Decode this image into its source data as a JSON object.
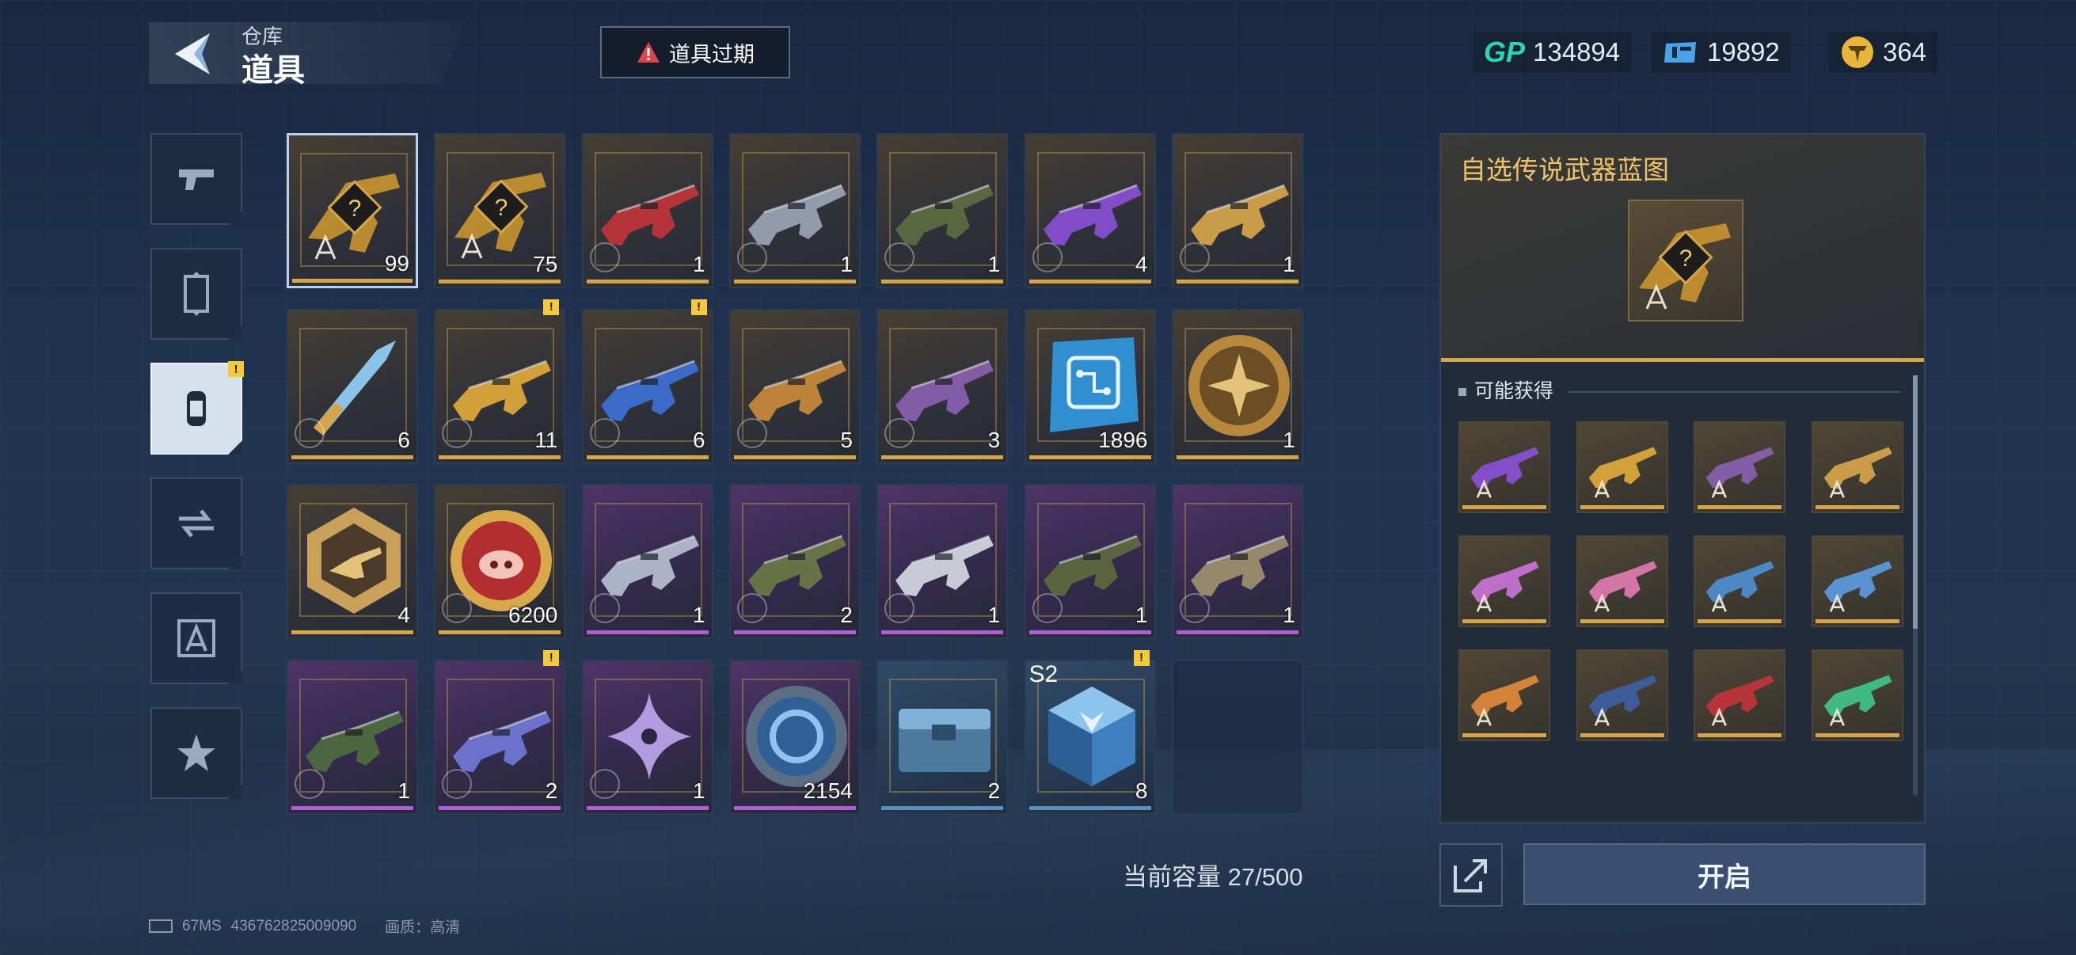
{
  "header": {
    "section_label": "仓库",
    "page_title": "道具",
    "expire_button_label": "道具过期"
  },
  "currencies": [
    {
      "icon": "gp-icon",
      "label": "GP",
      "value": "134894",
      "color": "#2fd3b0"
    },
    {
      "icon": "ticket-icon",
      "value": "19892",
      "color": "#4aa3e8"
    },
    {
      "icon": "gold-coin-icon",
      "value": "364",
      "color": "#e8b63a"
    }
  ],
  "side_nav": [
    {
      "icon": "pistol-icon",
      "active": false
    },
    {
      "icon": "skin-card-icon",
      "active": false
    },
    {
      "icon": "supply-item-icon",
      "active": true,
      "badge": "!"
    },
    {
      "icon": "transfer-icon",
      "active": false
    },
    {
      "icon": "blueprint-icon",
      "active": false
    },
    {
      "icon": "star-icon",
      "active": false
    }
  ],
  "items": [
    {
      "rarity": "gold",
      "art": "legendary-blueprint-icon",
      "count": "99",
      "selected": true
    },
    {
      "rarity": "gold",
      "art": "legendary-blueprint-icon",
      "count": "75"
    },
    {
      "rarity": "gold",
      "art": "red-rifle-icon",
      "count": "1",
      "timed": true,
      "accent": "#c0343b"
    },
    {
      "rarity": "gold",
      "art": "silver-rifle-icon",
      "count": "1",
      "timed": true,
      "accent": "#9aa4b6"
    },
    {
      "rarity": "gold",
      "art": "camo-rifle-icon",
      "count": "1",
      "timed": true,
      "accent": "#5c6b43"
    },
    {
      "rarity": "gold",
      "art": "purple-rifle-icon",
      "count": "4",
      "timed": true,
      "accent": "#8a4fd6"
    },
    {
      "rarity": "gold",
      "art": "gold-smg-icon",
      "count": "1",
      "timed": true,
      "accent": "#d6a54b"
    },
    {
      "rarity": "gold",
      "art": "knife-icon",
      "count": "6",
      "timed": true,
      "accent": "#8bc4e8"
    },
    {
      "rarity": "gold",
      "art": "gold-shotgun-icon",
      "count": "11",
      "timed": true,
      "badge": "!",
      "accent": "#e0a93a"
    },
    {
      "rarity": "gold",
      "art": "blue-rifle-icon",
      "count": "6",
      "timed": true,
      "badge": "!",
      "accent": "#3d6fd6"
    },
    {
      "rarity": "gold",
      "art": "pistol-icon",
      "count": "5",
      "timed": true,
      "accent": "#c98a3a"
    },
    {
      "rarity": "gold",
      "art": "sniper-rifle-icon",
      "count": "3",
      "timed": true,
      "accent": "#8a5fb0"
    },
    {
      "rarity": "gold",
      "art": "blueprint-chip-icon",
      "count": "1896",
      "accent": "#3f9ad6"
    },
    {
      "rarity": "gold",
      "art": "gold-cross-medal-icon",
      "count": "1",
      "accent": "#c99a45"
    },
    {
      "rarity": "gold",
      "art": "gold-hex-badge-icon",
      "count": "4",
      "accent": "#c99a45"
    },
    {
      "rarity": "gold",
      "art": "pig-coin-icon",
      "count": "6200",
      "timed": true,
      "accent": "#c23b3b"
    },
    {
      "rarity": "purple",
      "art": "silver-blaster-icon",
      "count": "1",
      "timed": true,
      "accent": "#b7bfd0"
    },
    {
      "rarity": "purple",
      "art": "camo-shotgun-icon",
      "count": "2",
      "timed": true,
      "accent": "#6b7a45"
    },
    {
      "rarity": "purple",
      "art": "white-rifle-icon",
      "count": "1",
      "timed": true,
      "accent": "#d5d9e0"
    },
    {
      "rarity": "purple",
      "art": "black-rifle-icon",
      "count": "1",
      "timed": true,
      "accent": "#5d6a3e"
    },
    {
      "rarity": "purple",
      "art": "tan-rifle-icon",
      "count": "1",
      "timed": true,
      "accent": "#a09070"
    },
    {
      "rarity": "purple",
      "art": "green-rifle-icon",
      "count": "1",
      "timed": true,
      "accent": "#4c6d3e"
    },
    {
      "rarity": "purple",
      "art": "blue-crossbow-icon",
      "count": "2",
      "timed": true,
      "badge": "!",
      "accent": "#6f78d6"
    },
    {
      "rarity": "purple",
      "art": "throwing-star-icon",
      "count": "1",
      "timed": true,
      "accent": "#a38ad6"
    },
    {
      "rarity": "purple",
      "art": "blue-token-icon",
      "count": "2154",
      "accent": "#3d8ac9"
    },
    {
      "rarity": "blue",
      "art": "supply-crate-icon",
      "count": "2",
      "accent": "#6fa9d0"
    },
    {
      "rarity": "blue",
      "art": "s2-cube-icon",
      "count": "8",
      "tag": "S2",
      "badge": "!",
      "accent": "#4e8fd0"
    },
    {
      "rarity": "empty"
    }
  ],
  "capacity_text": "当前容量 27/500",
  "detail_panel": {
    "title": "自选传说武器蓝图",
    "possible_label": "可能获得",
    "rewards": [
      {
        "art": "purple-rifle-icon",
        "accent": "#8a4fd6"
      },
      {
        "art": "gold-shotgun-icon",
        "accent": "#e0a93a"
      },
      {
        "art": "sniper-rifle-icon",
        "accent": "#8a5fb0"
      },
      {
        "art": "gold-rifle-icon",
        "accent": "#d6a54b"
      },
      {
        "art": "pink-rifle-icon",
        "accent": "#c873d6"
      },
      {
        "art": "pink-smg-icon",
        "accent": "#e07bb0"
      },
      {
        "art": "rainbow-pistol-icon",
        "accent": "#4e8fd0"
      },
      {
        "art": "blue-pistol-icon",
        "accent": "#5a9ae0"
      },
      {
        "art": "orange-rifle-icon",
        "accent": "#e08a3a"
      },
      {
        "art": "navy-rifle-icon",
        "accent": "#3d5fa0"
      },
      {
        "art": "red-blue-rifle-icon",
        "accent": "#c0343b"
      },
      {
        "art": "green-rifle-icon",
        "accent": "#3fc48a"
      }
    ],
    "open_button_label": "开启"
  },
  "footer": {
    "ping": "67MS",
    "uid": "436762825009090",
    "quality": "画质：高清"
  }
}
